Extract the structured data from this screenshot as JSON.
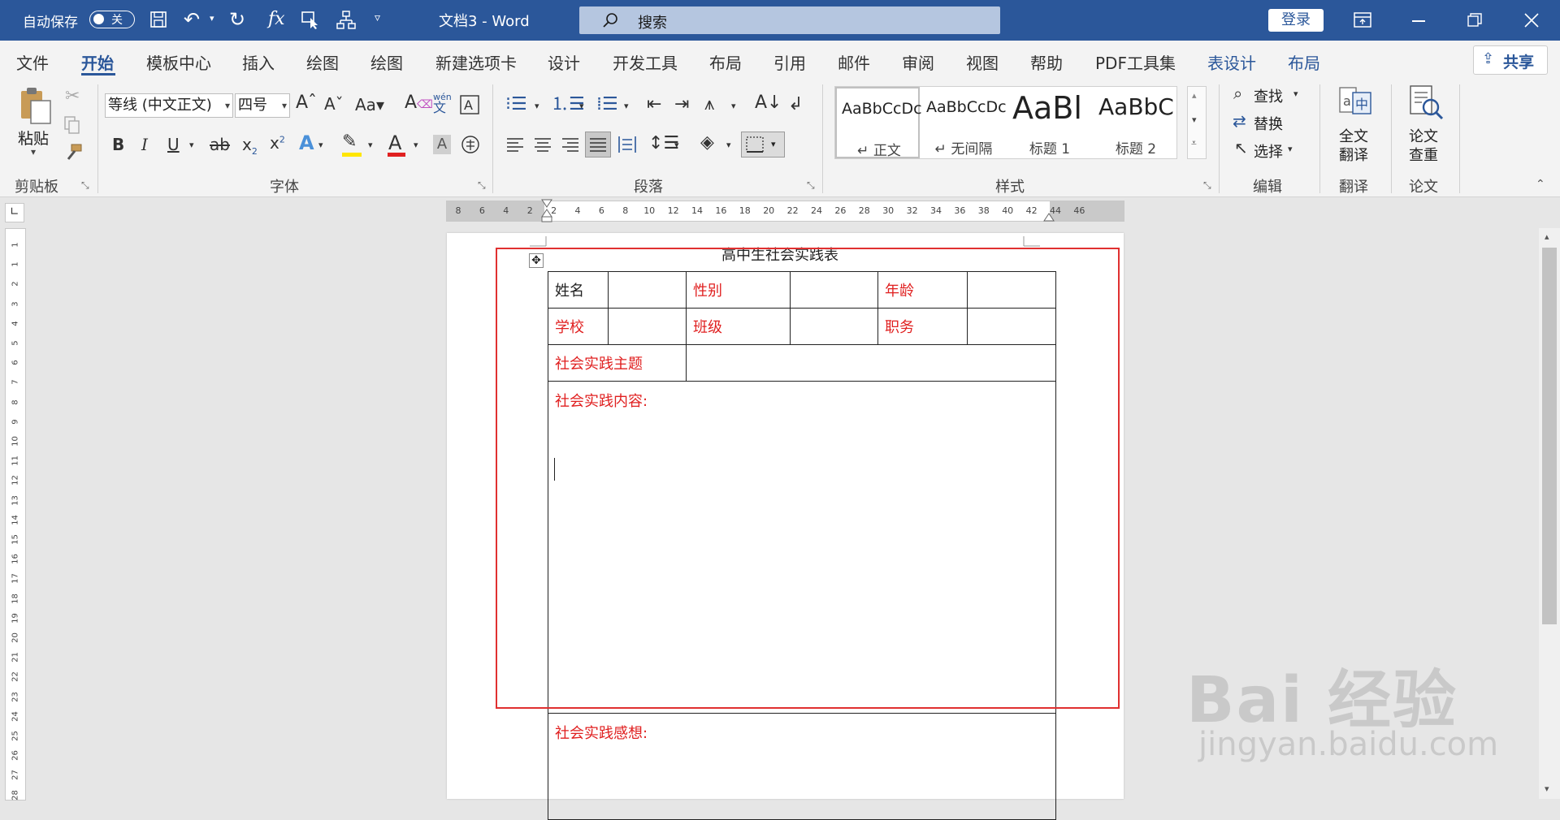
{
  "titlebar": {
    "autosave_label": "自动保存",
    "autosave_state": "关",
    "doc_title": "文档3  -  Word",
    "search_placeholder": "搜索",
    "login_label": "登录"
  },
  "menu": {
    "tabs": [
      "文件",
      "开始",
      "模板中心",
      "插入",
      "绘图",
      "绘图",
      "新建选项卡",
      "设计",
      "开发工具",
      "布局",
      "引用",
      "邮件",
      "审阅",
      "视图",
      "帮助",
      "PDF工具集",
      "表设计",
      "布局"
    ],
    "active_index": 1,
    "share_label": "共享"
  },
  "ribbon": {
    "clipboard": {
      "paste": "粘贴",
      "group": "剪贴板"
    },
    "font": {
      "font_name": "等线 (中文正文)",
      "font_size": "四号",
      "group": "字体",
      "phonetic_top": "wén",
      "phonetic_bottom": "文"
    },
    "paragraph": {
      "group": "段落"
    },
    "styles": {
      "group": "样式",
      "items": [
        {
          "preview": "AaBbCcDc",
          "name": "↵ 正文"
        },
        {
          "preview": "AaBbCcDc",
          "name": "↵ 无间隔"
        },
        {
          "preview": "AaBl",
          "name": "标题 1"
        },
        {
          "preview": "AaBbC",
          "name": "标题 2"
        }
      ]
    },
    "editing": {
      "find": "查找",
      "replace": "替换",
      "select": "选择",
      "group": "编辑"
    },
    "translate": {
      "full": "全文",
      "full2": "翻译",
      "group": "翻译"
    },
    "paper": {
      "check": "论文",
      "check2": "查重",
      "group": "论文"
    }
  },
  "ruler": {
    "h_ticks": [
      "8",
      "6",
      "4",
      "2",
      "2",
      "4",
      "6",
      "8",
      "10",
      "12",
      "14",
      "16",
      "18",
      "20",
      "22",
      "24",
      "26",
      "28",
      "30",
      "32",
      "34",
      "36",
      "38",
      "40",
      "42",
      "44",
      "46"
    ],
    "v_ticks": [
      "1",
      "1",
      "2",
      "3",
      "4",
      "5",
      "6",
      "7",
      "8",
      "9",
      "10",
      "11",
      "12",
      "13",
      "14",
      "15",
      "16",
      "17",
      "18",
      "19",
      "20",
      "21",
      "22",
      "23",
      "24",
      "25",
      "26",
      "27",
      "28"
    ]
  },
  "document": {
    "title": "高中生社会实践表",
    "row1": [
      "姓名",
      "",
      "性别",
      "",
      "年龄",
      ""
    ],
    "row2": [
      "学校",
      "",
      "班级",
      "",
      "职务",
      ""
    ],
    "row3": [
      "社会实践主题",
      ""
    ],
    "content_label": "社会实践内容:",
    "thoughts_label": "社会实践感想:"
  },
  "watermark": {
    "line1": "Bai 经验",
    "line2": "jingyan.baidu.com"
  }
}
